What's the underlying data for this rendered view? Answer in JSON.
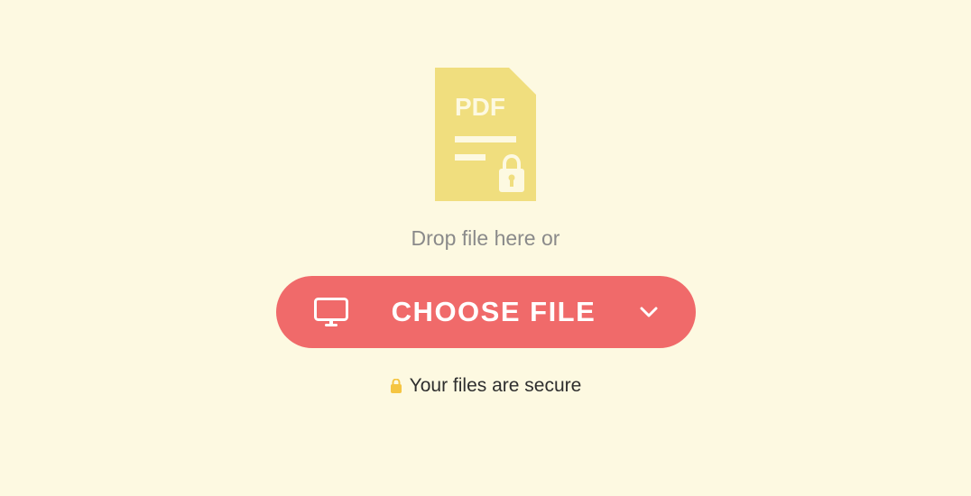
{
  "dropzone": {
    "prompt_text": "Drop file here or",
    "pdf_icon_label": "PDF"
  },
  "actions": {
    "choose_file_label": "CHOOSE FILE"
  },
  "security": {
    "message": "Your files are secure"
  },
  "colors": {
    "background": "#fdf9e1",
    "accent": "#f06a6a",
    "icon_yellow": "#f0de7e",
    "text_gray": "#8a8a8a",
    "text_dark": "#2e2e2e",
    "lock_gold": "#f5c542"
  }
}
